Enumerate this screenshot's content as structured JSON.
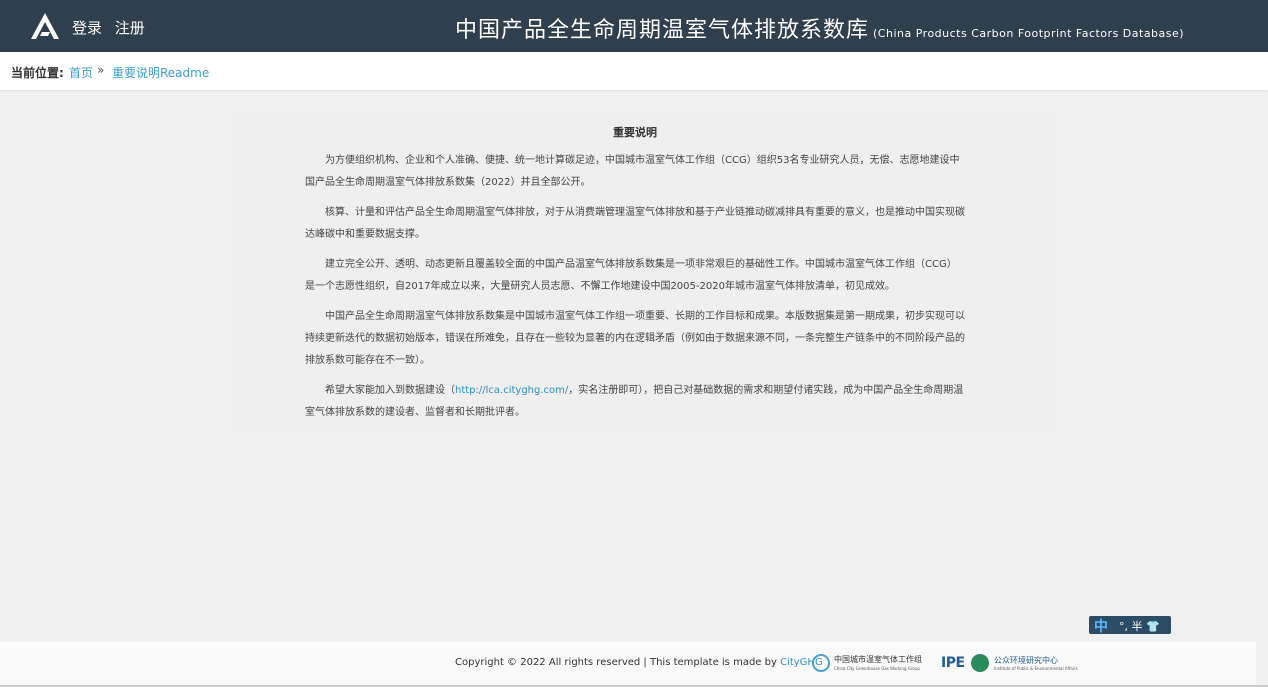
{
  "header": {
    "logo_icon": "ccg-logo-icon",
    "login": "登录",
    "register": "注册",
    "title": "中国产品全生命周期温室气体排放系数库",
    "subtitle": "(China Products Carbon Footprint Factors Database)"
  },
  "breadcrumb": {
    "label": "当前位置:",
    "home": "首页",
    "separator": "»",
    "current": "重要说明Readme"
  },
  "content": {
    "title": "重要说明",
    "p1": "为方便组织机构、企业和个人准确、便捷、统一地计算碳足迹，中国城市温室气体工作组（CCG）组织53名专业研究人员，无偿、志愿地建设中国产品全生命周期温室气体排放系数集（2022）并且全部公开。",
    "p2": "核算、计量和评估产品全生命周期温室气体排放，对于从消费端管理温室气体排放和基于产业链推动碳减排具有重要的意义，也是推动中国实现碳达峰碳中和重要数据支撑。",
    "p3": "建立完全公开、透明、动态更新且覆盖较全面的中国产品温室气体排放系数集是一项非常艰巨的基础性工作。中国城市温室气体工作组（CCG）是一个志愿性组织，自2017年成立以来，大量研究人员志愿、不懈工作地建设中国2005-2020年城市温室气体排放清单，初见成效。",
    "p4": "中国产品全生命周期温室气体排放系数集是中国城市温室气体工作组一项重要、长期的工作目标和成果。本版数据集是第一期成果，初步实现可以持续更新迭代的数据初始版本，错误在所难免，且存在一些较为显著的内在逻辑矛盾（例如由于数据来源不同，一条完整生产链条中的不同阶段产品的排放系数可能存在不一致）。",
    "p5_before": "希望大家能加入到数据建设（",
    "p5_link": "http://lca.cityghg.com/",
    "p5_after": "，实名注册即可），把自己对基础数据的需求和期望付诸实践，成为中国产品全生命周期温室气体排放系数的建设者、监督者和长期批评者。"
  },
  "ime": {
    "zh": "中",
    "rest": "°, 半 👕"
  },
  "footer": {
    "copyright": "Copyright © 2022 All rights reserved | This template is made by ",
    "link": "CityGHG",
    "partner1_cn": "中国城市温室气体工作组",
    "partner1_en": "China City Greenhouse Gas Working Group",
    "partner2_logo": "IPE",
    "partner2_cn": "公众环境研究中心",
    "partner2_en": "Institute of Public & Environmental Affairs"
  },
  "colors": {
    "header_bg": "#2f3f4e",
    "link": "#3c9fd0",
    "page_bg": "#f0f0f0"
  }
}
